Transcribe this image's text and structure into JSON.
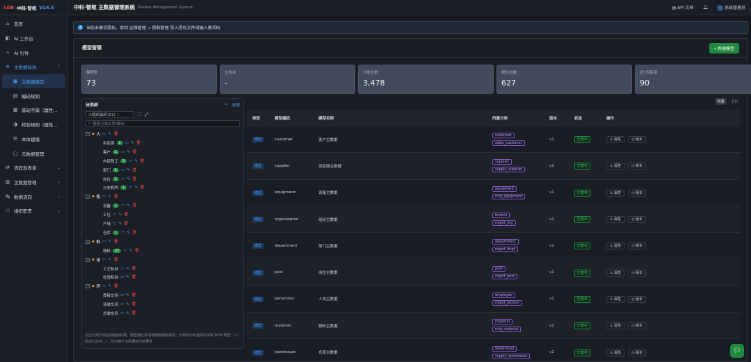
{
  "brand": {
    "mark": "SDB",
    "name": "中科·智枢",
    "version": "V14.5"
  },
  "header": {
    "title": "中科·智枢 主数据管理系统",
    "subtitle": "Master Management System",
    "api": "API 文档",
    "user": "系统管理员"
  },
  "nav": [
    {
      "icon": "⌂",
      "label": "首页",
      "level": 0
    },
    {
      "icon": "◧",
      "label": "AI 工作台",
      "level": 0
    },
    {
      "icon": "✧",
      "label": "AI 引导",
      "level": 0
    },
    {
      "icon": "⊕",
      "label": "主数据标准",
      "level": 0,
      "group": true,
      "chev": "⌃"
    },
    {
      "icon": "▣",
      "label": "主数据模型",
      "level": 1,
      "active": true
    },
    {
      "icon": "▤",
      "label": "编码规则",
      "level": 1
    },
    {
      "icon": "▦",
      "label": "基础字典（属性...",
      "level": 1
    },
    {
      "icon": "◑",
      "label": "校验规则（属性...",
      "level": 1
    },
    {
      "icon": "☰",
      "label": "本体建模",
      "level": 1
    },
    {
      "icon": "▢",
      "label": "元数据管理",
      "level": 1
    },
    {
      "icon": "⇄",
      "label": "流程及表单",
      "level": 0,
      "chev": "⌄"
    },
    {
      "icon": "▥",
      "label": "主数据管理",
      "level": 0,
      "chev": "⌄"
    },
    {
      "icon": "↹",
      "label": "数据流向",
      "level": 0,
      "chev": "⌄"
    },
    {
      "icon": "⚇",
      "label": "组织职责",
      "level": 0,
      "chev": "⌄"
    }
  ],
  "notice": "当前未激活授权。请到 运维管理 → 授权管理 导入授权文件或输入激活码",
  "panel": {
    "title": "模型管理",
    "new_button": "+ 新建模型"
  },
  "stats": [
    {
      "label": "模型数",
      "value": "73"
    },
    {
      "label": "文件夹",
      "value": "-"
    },
    {
      "label": "对象总数",
      "value": "3,478"
    },
    {
      "label": "属性总数",
      "value": "627"
    },
    {
      "label": "近7天新增",
      "value": "90"
    }
  ],
  "tree": {
    "title": "分类树",
    "all": "全部",
    "select": "人机料法环(21)",
    "search_placeholder": "搜索分类名称/编码",
    "nodes": [
      {
        "label": "人",
        "level": 0
      },
      {
        "label": "供应商",
        "level": 1,
        "badge": "3"
      },
      {
        "label": "客户",
        "level": 1,
        "badge": "1"
      },
      {
        "label": "内部员工",
        "level": 1,
        "badge": "3"
      },
      {
        "label": "部门",
        "level": 1,
        "badge": "1"
      },
      {
        "label": "岗位",
        "level": 1,
        "badge": "1"
      },
      {
        "label": "分支机构",
        "level": 1,
        "badge": "1"
      },
      {
        "label": "机",
        "level": 0
      },
      {
        "label": "设备",
        "level": 1,
        "badge": "1"
      },
      {
        "label": "工位",
        "level": 1
      },
      {
        "label": "产线",
        "level": 1
      },
      {
        "label": "仓库",
        "level": 1,
        "badge": "1"
      },
      {
        "label": "料",
        "level": 0
      },
      {
        "label": "物料",
        "level": 1,
        "badge": "22"
      },
      {
        "label": "法",
        "level": 0
      },
      {
        "label": "工艺标准",
        "level": 1
      },
      {
        "label": "检验标准",
        "level": 1
      },
      {
        "label": "环",
        "level": 0
      },
      {
        "label": "焊接车间",
        "level": 1
      },
      {
        "label": "涂装车间",
        "level": 1
      },
      {
        "label": "总装车间",
        "level": 1
      }
    ],
    "note": "点击分类节点后加载树目录。模型通过本地存储数据树获取。分类树为可选的的关联 BOM 模型（人/机/料/法/环...），也可用于主数据的分级要求"
  },
  "table": {
    "view_list": "列表",
    "view_card": "卡片",
    "columns": [
      "类型",
      "模型编码",
      "模型名称",
      "所属分类",
      "版本",
      "状态",
      "操作"
    ],
    "rows": [
      {
        "type": "模型",
        "code": "customer",
        "name": "客户主数据",
        "cats": [
          "customer",
          "sales_customer"
        ],
        "ver": "v1",
        "status": "已发布"
      },
      {
        "type": "模型",
        "code": "supplier",
        "name": "供应商主数据",
        "cats": [
          "supplier",
          "supply_supplier"
        ],
        "ver": "v1",
        "status": "已发布"
      },
      {
        "type": "模型",
        "code": "equipment",
        "name": "设备主数据",
        "cats": [
          "equipment",
          "mfg_equipment"
        ],
        "ver": "v1",
        "status": "已发布"
      },
      {
        "type": "模型",
        "code": "organization",
        "name": "组织主数据",
        "cats": [
          "branch",
          "mgmt_org"
        ],
        "ver": "v1",
        "status": "已发布"
      },
      {
        "type": "模型",
        "code": "department",
        "name": "部门主数据",
        "cats": [
          "department",
          "mgmt_dept"
        ],
        "ver": "v1",
        "status": "已发布"
      },
      {
        "type": "模型",
        "code": "post",
        "name": "岗位主数据",
        "cats": [
          "post",
          "mgmt_post"
        ],
        "ver": "v1",
        "status": "已发布"
      },
      {
        "type": "模型",
        "code": "personnel",
        "name": "人员主数据",
        "cats": [
          "employee",
          "mgmt_person"
        ],
        "ver": "v1",
        "status": "已发布"
      },
      {
        "type": "模型",
        "code": "material",
        "name": "物料主数据",
        "cats": [
          "material",
          "mfg_material"
        ],
        "ver": "v1",
        "status": "已发布"
      },
      {
        "type": "模型",
        "code": "warehouse",
        "name": "仓库主数据",
        "cats": [
          "warehouse",
          "supply_warehouse"
        ],
        "ver": "v1",
        "status": "已发布"
      }
    ],
    "op_attr": "属性",
    "op_ver": "版本"
  }
}
